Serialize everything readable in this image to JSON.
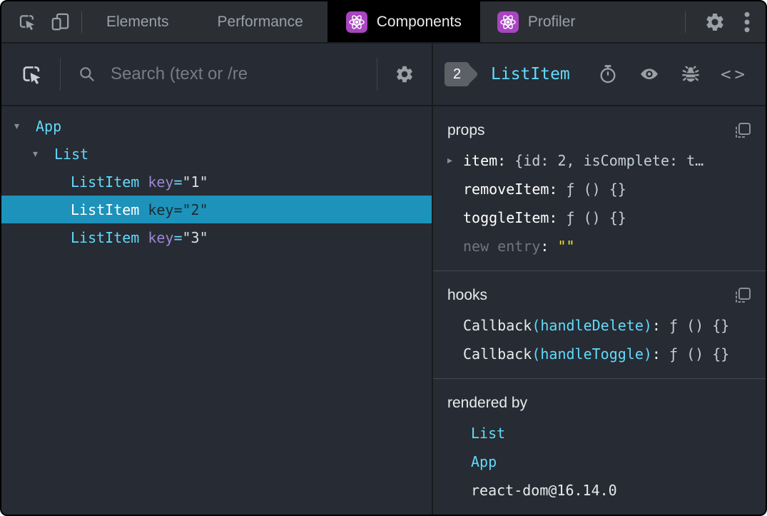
{
  "topbar": {
    "tabs": [
      {
        "label": "Elements",
        "active": false
      },
      {
        "label": "Performance",
        "active": false
      },
      {
        "label": "Components",
        "active": true
      },
      {
        "label": "Profiler",
        "active": false
      }
    ]
  },
  "left_panel": {
    "search": {
      "placeholder": "Search (text or /re"
    },
    "tree": [
      {
        "name": "App",
        "depth": 0,
        "expanded": true,
        "selected": false
      },
      {
        "name": "List",
        "depth": 1,
        "expanded": true,
        "selected": false
      },
      {
        "name": "ListItem",
        "depth": 2,
        "attr": "key",
        "eq": "=",
        "val": "\"1\"",
        "selected": false
      },
      {
        "name": "ListItem",
        "depth": 2,
        "attr": "key",
        "eq": "=",
        "val": "\"2\"",
        "selected": true
      },
      {
        "name": "ListItem",
        "depth": 2,
        "attr": "key",
        "eq": "=",
        "val": "\"3\"",
        "selected": false
      }
    ]
  },
  "right_panel": {
    "badge": "2",
    "component_name": "ListItem",
    "props": {
      "title": "props",
      "rows": [
        {
          "name": "item",
          "value": "{id: 2, isComplete: t…",
          "expandable": true
        },
        {
          "name": "removeItem",
          "value": "ƒ () {}"
        },
        {
          "name": "toggleItem",
          "value": "ƒ () {}"
        },
        {
          "name": "new entry",
          "value": "\"\"",
          "placeholder": true
        }
      ]
    },
    "hooks": {
      "title": "hooks",
      "rows": [
        {
          "base": "Callback",
          "sub": "(handleDelete)",
          "value": "ƒ () {}"
        },
        {
          "base": "Callback",
          "sub": "(handleToggle)",
          "value": "ƒ () {}"
        }
      ]
    },
    "rendered_by": {
      "title": "rendered by",
      "items": [
        {
          "label": "List",
          "link": true
        },
        {
          "label": "App",
          "link": true
        },
        {
          "label": "react-dom@16.14.0",
          "link": false
        }
      ]
    }
  },
  "glyphs": {
    "expanded": "▾",
    "collapsed": "▸",
    "colon": ": ",
    "code_icon": "<>"
  },
  "colors": {
    "accent_cyan": "#61dafb",
    "attr_purple": "#9d87d2",
    "selected_row_bg": "#1d93bb",
    "value_gray": "#c3ced8",
    "muted_icon_gray": "#9aa0a6",
    "editable_yellow": "#efe32e",
    "react_purple": "#a845c0",
    "panel_bg": "#272b33",
    "topbar_bg": "#2b2e33",
    "active_tab_bg": "#000000"
  }
}
